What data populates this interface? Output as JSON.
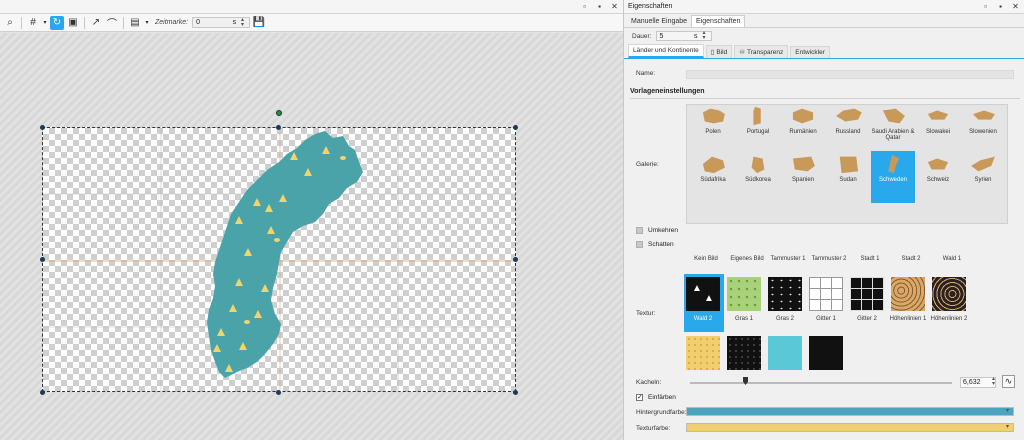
{
  "left": {
    "toolbar": {
      "time_label": "Zeitmarke:",
      "time_value": "0",
      "time_unit": "s"
    }
  },
  "right": {
    "title": "Eigenschaften",
    "tabs": [
      "Manuelle Eingabe",
      "Eigenschaften"
    ],
    "dauer": {
      "label": "Dauer:",
      "value": "5",
      "unit": "s"
    },
    "subtabs": [
      "Länder und Kontinente",
      "Bild",
      "Transparenz",
      "Entwickler"
    ],
    "name_label": "Name:",
    "section_title": "Vorlageneinstellungen",
    "galerie_label": "Galerie:",
    "gallery_row1": [
      "Polen",
      "Portugal",
      "Rumänien",
      "Russland",
      "Saudi Arabien & Qatar",
      "Slowakei",
      "Slowenien"
    ],
    "gallery_row2": [
      "Südafrika",
      "Südkorea",
      "Spanien",
      "Sudan",
      "Schweden",
      "Schweiz",
      "Syrien"
    ],
    "selected_country": "Schweden",
    "checkboxes": [
      {
        "label": "Umkehren",
        "checked": false
      },
      {
        "label": "Schatten",
        "checked": false
      }
    ],
    "textur_label": "Textur:",
    "texture_headers": [
      "Kein Bild",
      "Eigenes Bild",
      "Tarnmuster 1",
      "Tarnmuster 2",
      "Stadt 1",
      "Stadt 2",
      "Wald 1"
    ],
    "texture_labels": [
      "Wald 2",
      "Gras 1",
      "Gras 2",
      "Gitter 1",
      "Gitter 2",
      "Höhenlinien 1",
      "Höhenlinien 2"
    ],
    "selected_texture": "Wald 2",
    "kacheln_label": "Kacheln:",
    "kacheln_value": "6,632",
    "kacheln_level": 0.21,
    "einfaerben_label": "Einfärben",
    "einfaerben_checked": true,
    "hintergrund_label": "Hintergrundfarbe:",
    "hintergrund_color": "#4aa3bf",
    "texturfarbe_label": "Texturfarbe:",
    "texturfarbe_color": "#f2cf6e"
  },
  "colors": {
    "accent": "#2aa8ec",
    "country_fill": "#4aa3a8",
    "tree_fill": "#f3d46c",
    "gallery_shape": "#c9995a"
  }
}
